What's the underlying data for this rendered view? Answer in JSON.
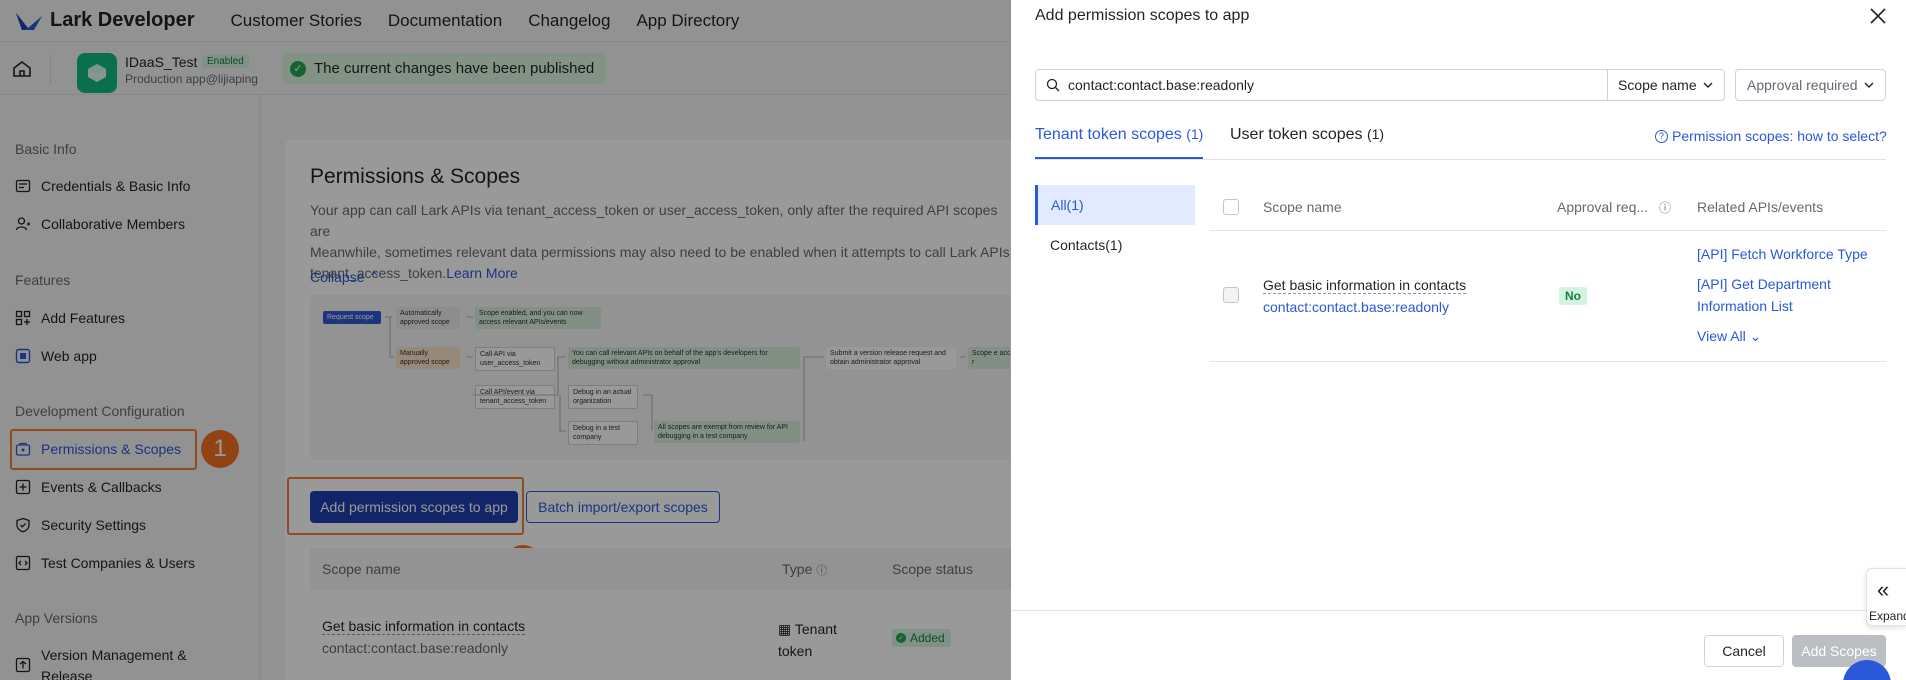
{
  "topnav": {
    "brand": "Lark Developer",
    "links": [
      "Customer Stories",
      "Documentation",
      "Changelog",
      "App Directory"
    ]
  },
  "appbar": {
    "app_name": "IDaaS_Test",
    "app_status": "Enabled",
    "app_sub": "Production app@lijiaping",
    "publish_msg": "The current changes have been published"
  },
  "sidebar": {
    "sections": [
      {
        "title": "Basic Info",
        "items": [
          "Credentials & Basic Info",
          "Collaborative Members"
        ]
      },
      {
        "title": "Features",
        "items": [
          "Add Features",
          "Web app"
        ]
      },
      {
        "title": "Development Configuration",
        "items": [
          "Permissions & Scopes",
          "Events & Callbacks",
          "Security Settings",
          "Test Companies & Users"
        ]
      },
      {
        "title": "App Versions",
        "items": [
          "Version Management & Release"
        ]
      }
    ],
    "active": "Permissions & Scopes"
  },
  "annotations": {
    "one": "1",
    "two": "2"
  },
  "main": {
    "title": "Permissions & Scopes",
    "desc1": "Your app can call Lark APIs via tenant_access_token or user_access_token, only after the required API scopes are",
    "desc2": "Meanwhile, sometimes relevant data permissions may also need to be enabled when it attempts to call Lark APIs",
    "desc3": "tenant_access_token.",
    "learn_more": "Learn More",
    "collapse": "Collapse",
    "flow": {
      "request": "Request scope",
      "auto": "Automatically approved scope",
      "auto_result": "Scope enabled, and you can now access relevant APIs/events",
      "manual": "Manually approved scope",
      "call_user": "Call API via user_access_token",
      "call_user_result": "You can call relevant APIs on behalf of the app's developers for debugging without administrator approval",
      "submit": "Submit a version release request and obtain administrator approval",
      "scope_e": "Scope e access r",
      "call_tenant": "Call API/event via tenant_access_token",
      "debug_actual": "Debug in an actual organization",
      "debug_test": "Debug in a test company",
      "exempt": "All scopes are exempt from review for API debugging in a test company"
    },
    "add_btn": "Add permission scopes to app",
    "batch_btn": "Batch import/export scopes",
    "table": {
      "headers": [
        "Scope name",
        "Type",
        "Scope status"
      ],
      "row": {
        "name": "Get basic information in contacts",
        "scope": "contact:contact.base:readonly",
        "type1": "Tenant",
        "type2": "token",
        "status": "Added"
      }
    }
  },
  "drawer": {
    "title": "Add permission scopes to app",
    "search_value": "contact:contact.base:readonly",
    "filter1": "Scope name",
    "filter2": "Approval required",
    "tab1": "Tenant token scopes",
    "tab1_count": "(1)",
    "tab2": "User token scopes",
    "tab2_count": "(1)",
    "how_link": "Permission scopes: how to select?",
    "categories": [
      "All(1)",
      "Contacts(1)"
    ],
    "headers": [
      "Scope name",
      "Approval req...",
      "Related APIs/events"
    ],
    "row": {
      "name": "Get basic information in contacts",
      "scope": "contact:contact.base:readonly",
      "approval": "No",
      "api1": "[API] Fetch Workforce Type",
      "api2a": "[API] Get Department",
      "api2b": "Information List",
      "view_all": "View All"
    },
    "cancel": "Cancel",
    "add": "Add Scopes",
    "expand": "Expand"
  }
}
